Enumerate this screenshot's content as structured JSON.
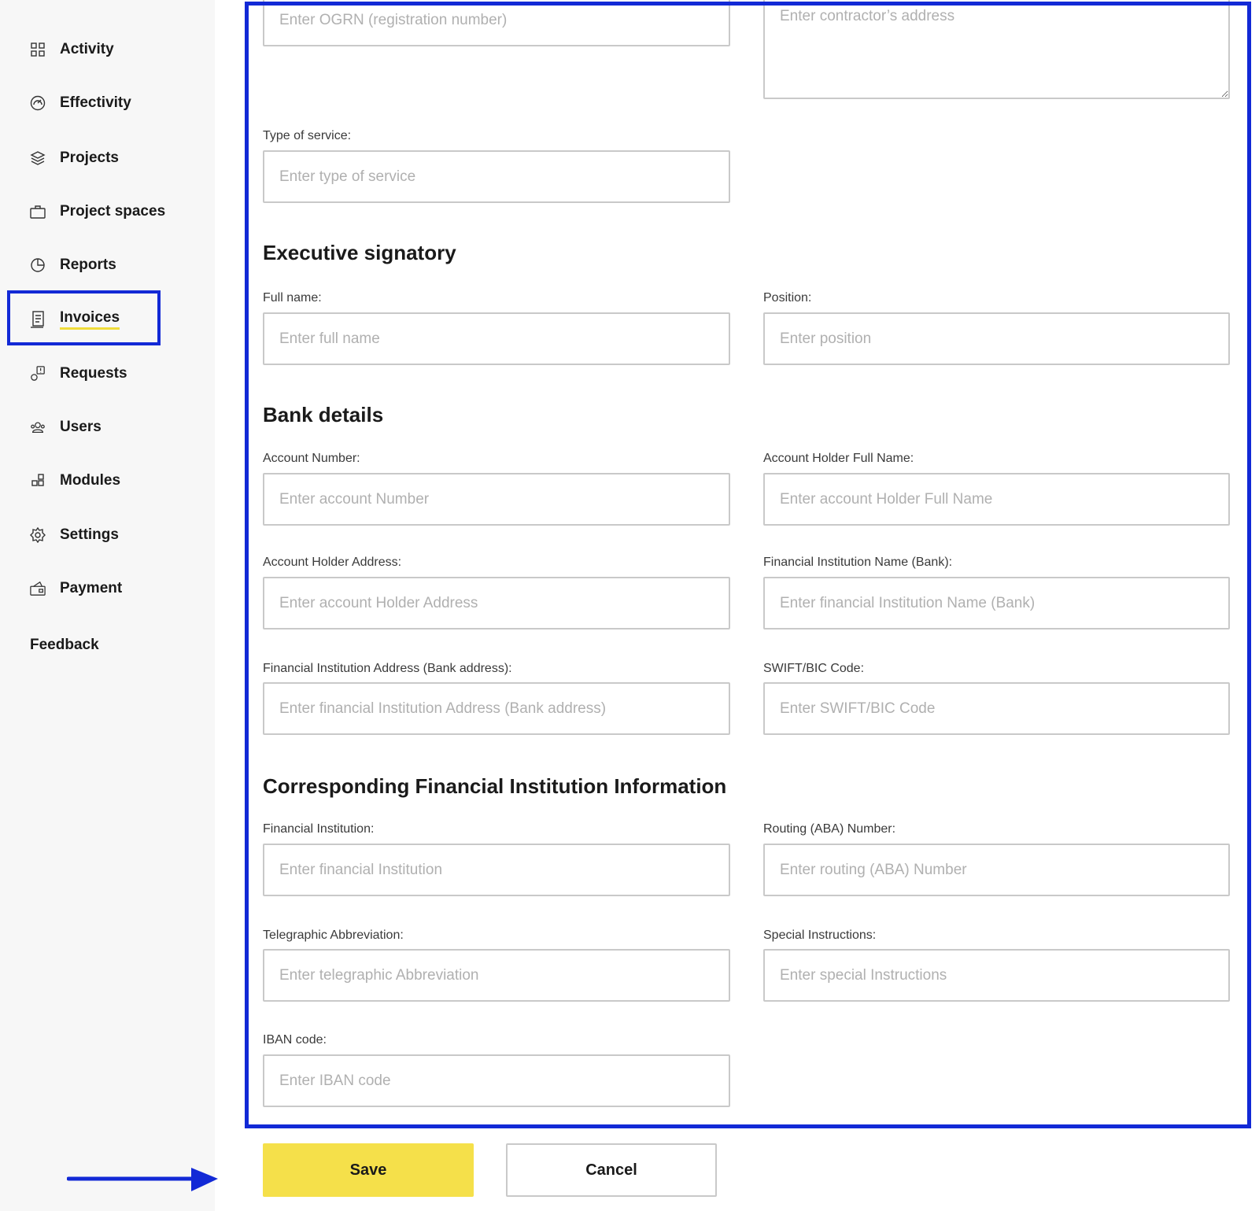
{
  "sidebar": {
    "items": [
      {
        "label": "Activity",
        "icon": "grid-icon"
      },
      {
        "label": "Effectivity",
        "icon": "gauge-icon"
      },
      {
        "label": "Projects",
        "icon": "layers-icon"
      },
      {
        "label": "Project spaces",
        "icon": "briefcase-icon"
      },
      {
        "label": "Reports",
        "icon": "pie-chart-icon"
      },
      {
        "label": "Invoices",
        "icon": "document-icon",
        "active": true
      },
      {
        "label": "Requests",
        "icon": "request-icon"
      },
      {
        "label": "Users",
        "icon": "users-icon"
      },
      {
        "label": "Modules",
        "icon": "modules-icon"
      },
      {
        "label": "Settings",
        "icon": "gear-icon"
      },
      {
        "label": "Payment",
        "icon": "payment-icon"
      }
    ],
    "feedback_label": "Feedback"
  },
  "form": {
    "ogrn": {
      "placeholder": "Enter OGRN (registration number)"
    },
    "contractor_address": {
      "placeholder": "Enter contractor’s address"
    },
    "type_of_service": {
      "label": "Type of service:",
      "placeholder": "Enter type of service"
    },
    "executive_signatory": {
      "heading": "Executive signatory",
      "full_name": {
        "label": "Full name:",
        "placeholder": "Enter full name"
      },
      "position": {
        "label": "Position:",
        "placeholder": "Enter position"
      }
    },
    "bank_details": {
      "heading": "Bank details",
      "account_number": {
        "label": "Account Number:",
        "placeholder": "Enter account Number"
      },
      "account_holder_full_name": {
        "label": "Account Holder Full Name:",
        "placeholder": "Enter account Holder Full Name"
      },
      "account_holder_address": {
        "label": "Account Holder Address:",
        "placeholder": "Enter account Holder Address"
      },
      "fi_name": {
        "label": "Financial Institution Name (Bank):",
        "placeholder": "Enter financial Institution Name (Bank)"
      },
      "fi_address": {
        "label": "Financial Institution Address (Bank address):",
        "placeholder": "Enter financial Institution Address (Bank address)"
      },
      "swift": {
        "label": "SWIFT/BIC Code:",
        "placeholder": "Enter SWIFT/BIC Code"
      }
    },
    "corresponding": {
      "heading": "Corresponding Financial Institution Information",
      "financial_institution": {
        "label": "Financial Institution:",
        "placeholder": "Enter financial Institution"
      },
      "routing": {
        "label": "Routing (ABA) Number:",
        "placeholder": "Enter routing (ABA) Number"
      },
      "telegraphic": {
        "label": "Telegraphic Abbreviation:",
        "placeholder": "Enter telegraphic Abbreviation"
      },
      "special": {
        "label": "Special Instructions:",
        "placeholder": "Enter special Instructions"
      },
      "iban": {
        "label": "IBAN code:",
        "placeholder": "Enter IBAN code"
      }
    }
  },
  "actions": {
    "save_label": "Save",
    "cancel_label": "Cancel"
  },
  "colors": {
    "accent_yellow": "#f5e04a",
    "highlight_blue": "#1229d6",
    "active_underline": "#f0dc3a"
  }
}
